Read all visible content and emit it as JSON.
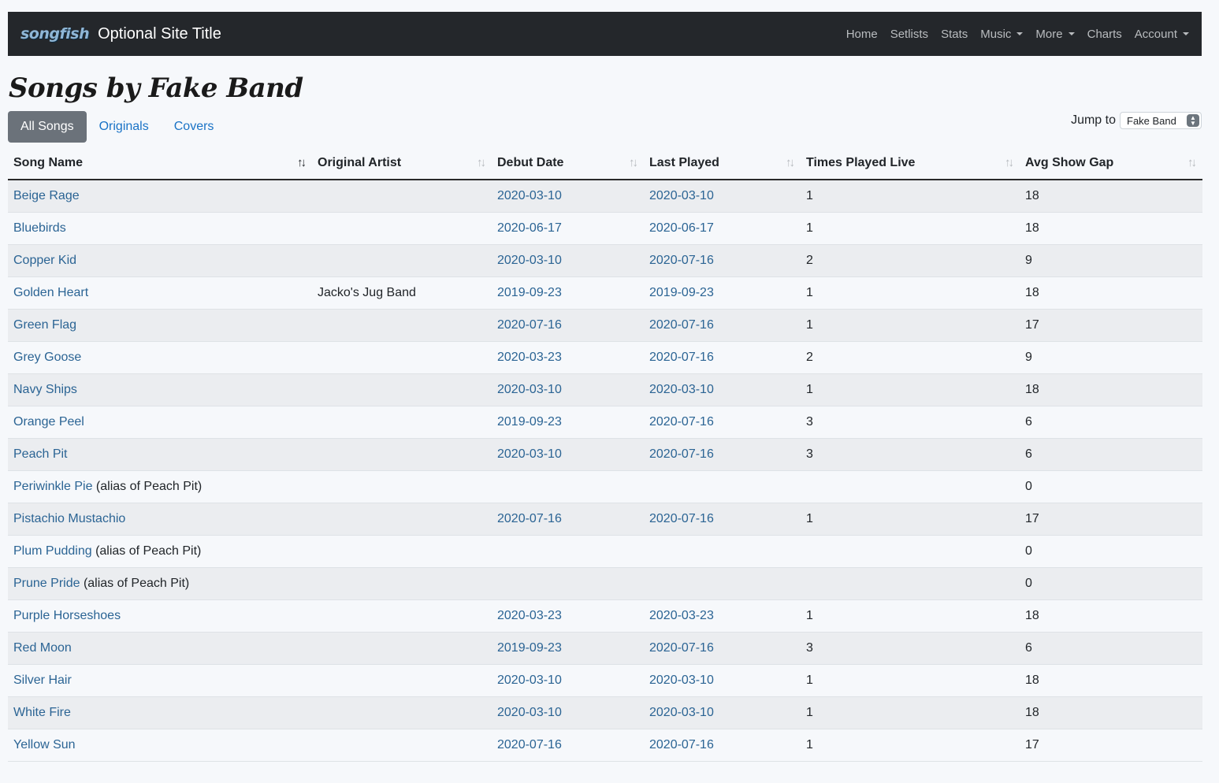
{
  "nav": {
    "logo": "songfish",
    "site_title": "Optional Site Title",
    "links": [
      {
        "label": "Home",
        "dropdown": false
      },
      {
        "label": "Setlists",
        "dropdown": false
      },
      {
        "label": "Stats",
        "dropdown": false
      },
      {
        "label": "Music",
        "dropdown": true
      },
      {
        "label": "More",
        "dropdown": true
      },
      {
        "label": "Charts",
        "dropdown": false
      },
      {
        "label": "Account",
        "dropdown": true
      }
    ]
  },
  "page_title": "Songs by Fake Band",
  "tabs": [
    {
      "label": "All Songs",
      "active": true
    },
    {
      "label": "Originals",
      "active": false
    },
    {
      "label": "Covers",
      "active": false
    }
  ],
  "jump_to": {
    "label": "Jump to",
    "selected": "Fake Band"
  },
  "table": {
    "columns": [
      {
        "label": "Song Name",
        "sorted": true
      },
      {
        "label": "Original Artist",
        "sorted": false
      },
      {
        "label": "Debut Date",
        "sorted": false
      },
      {
        "label": "Last Played",
        "sorted": false
      },
      {
        "label": "Times Played Live",
        "sorted": false
      },
      {
        "label": "Avg Show Gap",
        "sorted": false
      }
    ],
    "rows": [
      {
        "song": "Beige Rage",
        "alias": "",
        "artist": "",
        "debut": "2020-03-10",
        "last": "2020-03-10",
        "times": "1",
        "gap": "18"
      },
      {
        "song": "Bluebirds",
        "alias": "",
        "artist": "",
        "debut": "2020-06-17",
        "last": "2020-06-17",
        "times": "1",
        "gap": "18"
      },
      {
        "song": "Copper Kid",
        "alias": "",
        "artist": "",
        "debut": "2020-03-10",
        "last": "2020-07-16",
        "times": "2",
        "gap": "9"
      },
      {
        "song": "Golden Heart",
        "alias": "",
        "artist": "Jacko's Jug Band",
        "debut": "2019-09-23",
        "last": "2019-09-23",
        "times": "1",
        "gap": "18"
      },
      {
        "song": "Green Flag",
        "alias": "",
        "artist": "",
        "debut": "2020-07-16",
        "last": "2020-07-16",
        "times": "1",
        "gap": "17"
      },
      {
        "song": "Grey Goose",
        "alias": "",
        "artist": "",
        "debut": "2020-03-23",
        "last": "2020-07-16",
        "times": "2",
        "gap": "9"
      },
      {
        "song": "Navy Ships",
        "alias": "",
        "artist": "",
        "debut": "2020-03-10",
        "last": "2020-03-10",
        "times": "1",
        "gap": "18"
      },
      {
        "song": "Orange Peel",
        "alias": "",
        "artist": "",
        "debut": "2019-09-23",
        "last": "2020-07-16",
        "times": "3",
        "gap": "6"
      },
      {
        "song": "Peach Pit",
        "alias": "",
        "artist": "",
        "debut": "2020-03-10",
        "last": "2020-07-16",
        "times": "3",
        "gap": "6"
      },
      {
        "song": "Periwinkle Pie",
        "alias": "(alias of Peach Pit)",
        "artist": "",
        "debut": "",
        "last": "",
        "times": "",
        "gap": "0"
      },
      {
        "song": "Pistachio Mustachio",
        "alias": "",
        "artist": "",
        "debut": "2020-07-16",
        "last": "2020-07-16",
        "times": "1",
        "gap": "17"
      },
      {
        "song": "Plum Pudding",
        "alias": "(alias of Peach Pit)",
        "artist": "",
        "debut": "",
        "last": "",
        "times": "",
        "gap": "0"
      },
      {
        "song": "Prune Pride",
        "alias": "(alias of Peach Pit)",
        "artist": "",
        "debut": "",
        "last": "",
        "times": "",
        "gap": "0"
      },
      {
        "song": "Purple Horseshoes",
        "alias": "",
        "artist": "",
        "debut": "2020-03-23",
        "last": "2020-03-23",
        "times": "1",
        "gap": "18"
      },
      {
        "song": "Red Moon",
        "alias": "",
        "artist": "",
        "debut": "2019-09-23",
        "last": "2020-07-16",
        "times": "3",
        "gap": "6"
      },
      {
        "song": "Silver Hair",
        "alias": "",
        "artist": "",
        "debut": "2020-03-10",
        "last": "2020-03-10",
        "times": "1",
        "gap": "18"
      },
      {
        "song": "White Fire",
        "alias": "",
        "artist": "",
        "debut": "2020-03-10",
        "last": "2020-03-10",
        "times": "1",
        "gap": "18"
      },
      {
        "song": "Yellow Sun",
        "alias": "",
        "artist": "",
        "debut": "2020-07-16",
        "last": "2020-07-16",
        "times": "1",
        "gap": "17"
      }
    ]
  },
  "colors": {
    "navbar": "#24272b",
    "link": "#2b6494",
    "tab_active": "#6b727a"
  }
}
